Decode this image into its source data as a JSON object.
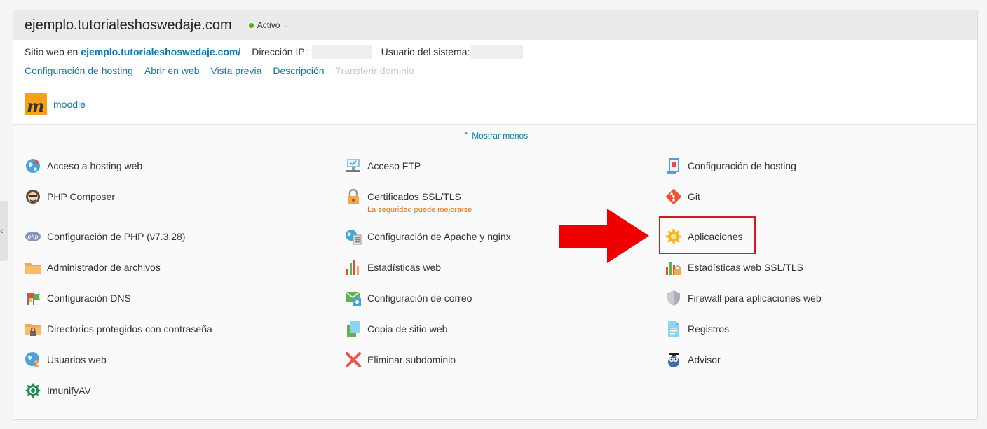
{
  "domain": {
    "title": "ejemplo.tutorialeshoswedaje.com",
    "status": "Activo",
    "website_prefix": "Sitio web en",
    "website_link": "ejemplo.tutorialeshoswedaje.com/",
    "ip_label": "Dirección IP:",
    "user_label": "Usuario del sistema:"
  },
  "links": [
    {
      "label": "Configuración de hosting",
      "enabled": true
    },
    {
      "label": "Abrir en web",
      "enabled": true
    },
    {
      "label": "Vista previa",
      "enabled": true
    },
    {
      "label": "Descripción",
      "enabled": true
    },
    {
      "label": "Transferir dominio",
      "enabled": false
    }
  ],
  "app": {
    "name": "moodle"
  },
  "show_less": "Mostrar menos",
  "tools": {
    "col1": [
      {
        "label": "Acceso a hosting web",
        "icon": "globe-icon"
      },
      {
        "label": "PHP Composer",
        "icon": "composer-icon"
      },
      {
        "label": "Configuración de PHP (v7.3.28)",
        "icon": "php-icon"
      },
      {
        "label": "Administrador de archivos",
        "icon": "folder-icon"
      },
      {
        "label": "Configuración DNS",
        "icon": "dns-flags-icon"
      },
      {
        "label": "Directorios protegidos con contraseña",
        "icon": "locked-folder-icon"
      },
      {
        "label": "Usuarios web",
        "icon": "web-users-icon"
      },
      {
        "label": "ImunifyAV",
        "icon": "imunify-icon"
      }
    ],
    "col2": [
      {
        "label": "Acceso FTP",
        "icon": "ftp-icon"
      },
      {
        "label": "Certificados SSL/TLS",
        "icon": "ssl-lock-icon",
        "warning": "La seguridad puede mejorarse"
      },
      {
        "label": "Configuración de Apache y nginx",
        "icon": "apache-icon"
      },
      {
        "label": "Estadísticas web",
        "icon": "bar-chart-icon"
      },
      {
        "label": "Configuración de correo",
        "icon": "mail-icon"
      },
      {
        "label": "Copia de sitio web",
        "icon": "copy-icon"
      },
      {
        "label": "Eliminar subdominio",
        "icon": "delete-x-icon"
      }
    ],
    "col3": [
      {
        "label": "Configuración de hosting",
        "icon": "hosting-config-icon"
      },
      {
        "label": "Git",
        "icon": "git-icon"
      },
      {
        "label": "Aplicaciones",
        "icon": "gear-icon"
      },
      {
        "label": "Estadísticas web SSL/TLS",
        "icon": "ssl-chart-icon"
      },
      {
        "label": "Firewall para aplicaciones web",
        "icon": "shield-icon"
      },
      {
        "label": "Registros",
        "icon": "logs-icon"
      },
      {
        "label": "Advisor",
        "icon": "advisor-owl-icon"
      }
    ]
  },
  "colors": {
    "link": "#0f7ba7",
    "warning": "#e8740c",
    "highlight": "#d71920",
    "arrow": "#ee0000",
    "active": "#5fa81f"
  }
}
